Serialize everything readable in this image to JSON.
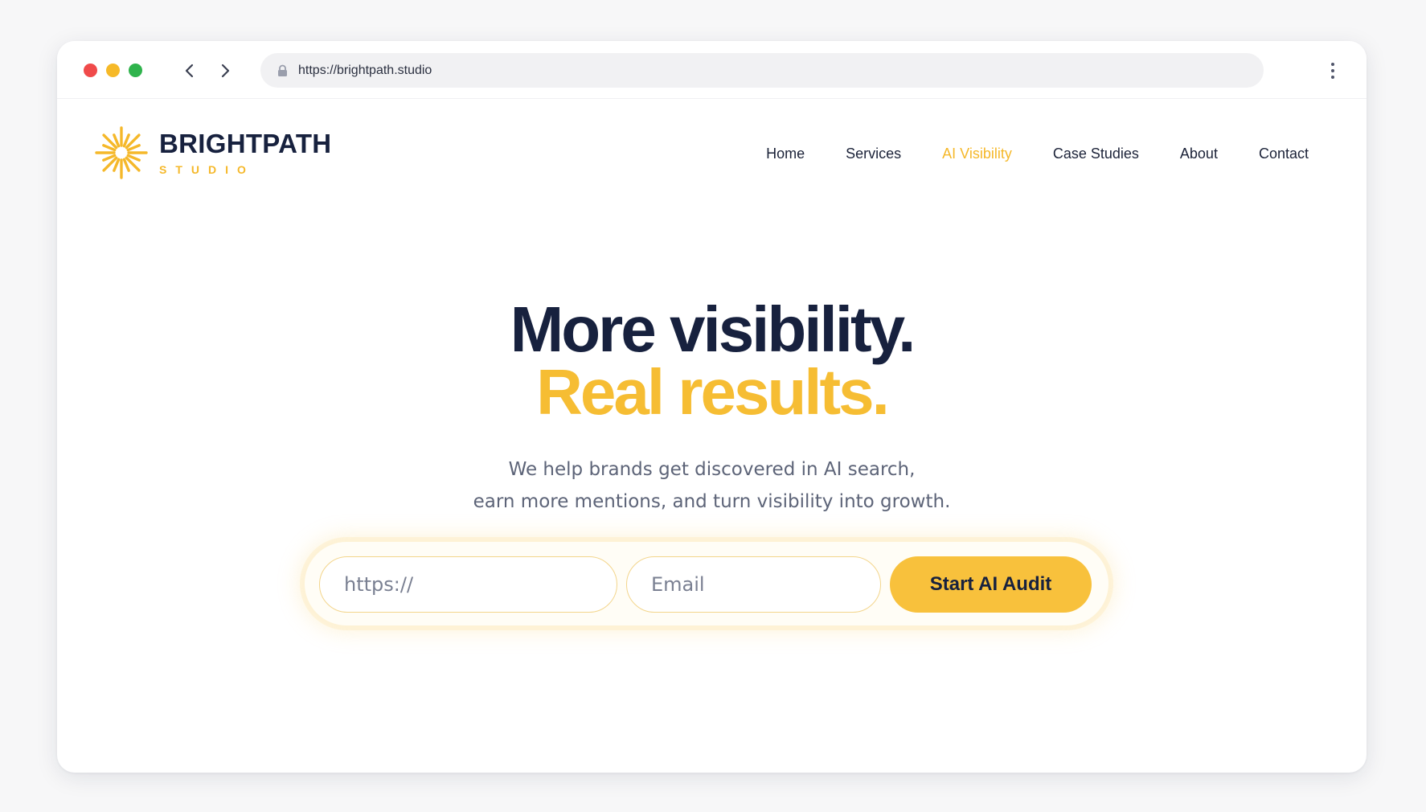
{
  "browser": {
    "url": "https://brightpath.studio",
    "icons": {
      "back": "chevron-left-icon",
      "forward": "chevron-right-icon",
      "lock": "lock-icon",
      "menu": "kebab-menu-icon"
    }
  },
  "brand": {
    "name": "BRIGHTPATH",
    "subtitle": "STUDIO",
    "logo_icon": "sunburst-icon",
    "accent_color": "#f5b82a",
    "navy_color": "#17213e"
  },
  "nav": {
    "items": [
      {
        "label": "Home",
        "active": false
      },
      {
        "label": "Services",
        "active": false
      },
      {
        "label": "AI Visibility",
        "active": true
      },
      {
        "label": "Case Studies",
        "active": false
      },
      {
        "label": "About",
        "active": false
      },
      {
        "label": "Contact",
        "active": false
      }
    ]
  },
  "hero": {
    "headline_line1": "More visibility.",
    "headline_line2": "Real results.",
    "subtext_line1": "We help brands get discovered in AI search,",
    "subtext_line2": "earn more mentions, and turn visibility into growth."
  },
  "audit_form": {
    "url_placeholder": "https://",
    "email_placeholder": "Email",
    "submit_label": "Start AI Audit",
    "button_color": "#f8c13c"
  }
}
